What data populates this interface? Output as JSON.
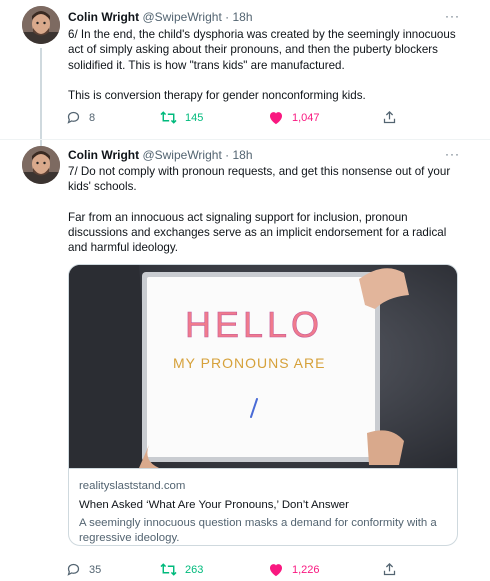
{
  "tweets": [
    {
      "author": {
        "name": "Colin Wright",
        "handle": "@SwipeWright",
        "separator": "·",
        "time": "18h"
      },
      "more_label": "···",
      "paragraphs": [
        "6/ In the end, the child's dysphoria was created by the seemingly innocuous act of simply asking about their pronouns, and then the puberty blockers solidified it. This is how \"trans kids\" are manufactured.",
        "This is conversion therapy for gender nonconforming kids."
      ],
      "stats": {
        "replies": "8",
        "retweets": "145",
        "likes": "1,047"
      }
    },
    {
      "author": {
        "name": "Colin Wright",
        "handle": "@SwipeWright",
        "separator": "·",
        "time": "18h"
      },
      "more_label": "···",
      "paragraphs": [
        "7/ Do not comply with pronoun requests, and get this nonsense out of your kids' schools.",
        "Far from an innocuous act signaling support for inclusion, pronoun discussions and exchanges serve as an implicit endorsement for a radical and harmful ideology."
      ],
      "card": {
        "image_text_line1": "HELLO",
        "image_text_line2": "MY PRONOUNS ARE",
        "domain": "realityslaststand.com",
        "title": "When Asked ‘What Are Your Pronouns,’ Don’t Answer",
        "description": "A seemingly innocuous question masks a demand for conformity with a regressive ideology."
      },
      "stats": {
        "replies": "35",
        "retweets": "263",
        "likes": "1,226"
      }
    }
  ],
  "icons": {
    "reply": "reply-icon",
    "retweet": "retweet-icon",
    "like": "heart-icon",
    "share": "share-icon",
    "more": "more-icon"
  },
  "colors": {
    "text": "#0f1419",
    "secondary": "#536471",
    "retweet_active": "#00ba7c",
    "like_active": "#f91880",
    "thread_line": "#cfd9de"
  }
}
